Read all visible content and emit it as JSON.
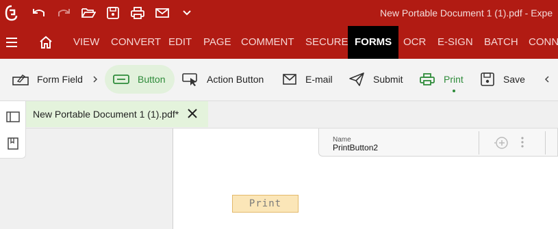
{
  "titlebar": {
    "title": "New Portable Document 1 (1).pdf  -  Expe"
  },
  "menu": {
    "items": [
      "VIEW",
      "CONVERT",
      "EDIT",
      "PAGE",
      "COMMENT",
      "SECURE",
      "FORMS",
      "OCR",
      "E-SIGN",
      "BATCH",
      "CONN"
    ],
    "active": "FORMS"
  },
  "ribbon": {
    "form_field": "Form Field",
    "button": "Button",
    "action_button": "Action Button",
    "email": "E-mail",
    "submit": "Submit",
    "print": "Print",
    "save": "Save"
  },
  "document_tab": {
    "title": "New Portable Document 1 (1).pdf*"
  },
  "properties": {
    "name_label": "Name",
    "name_value": "PrintButton2"
  },
  "canvas": {
    "print_button_text": "Print"
  },
  "colors": {
    "brand_red": "#b11b13",
    "accent_green": "#2e8b3a",
    "field_fill": "#fbe6b8"
  }
}
